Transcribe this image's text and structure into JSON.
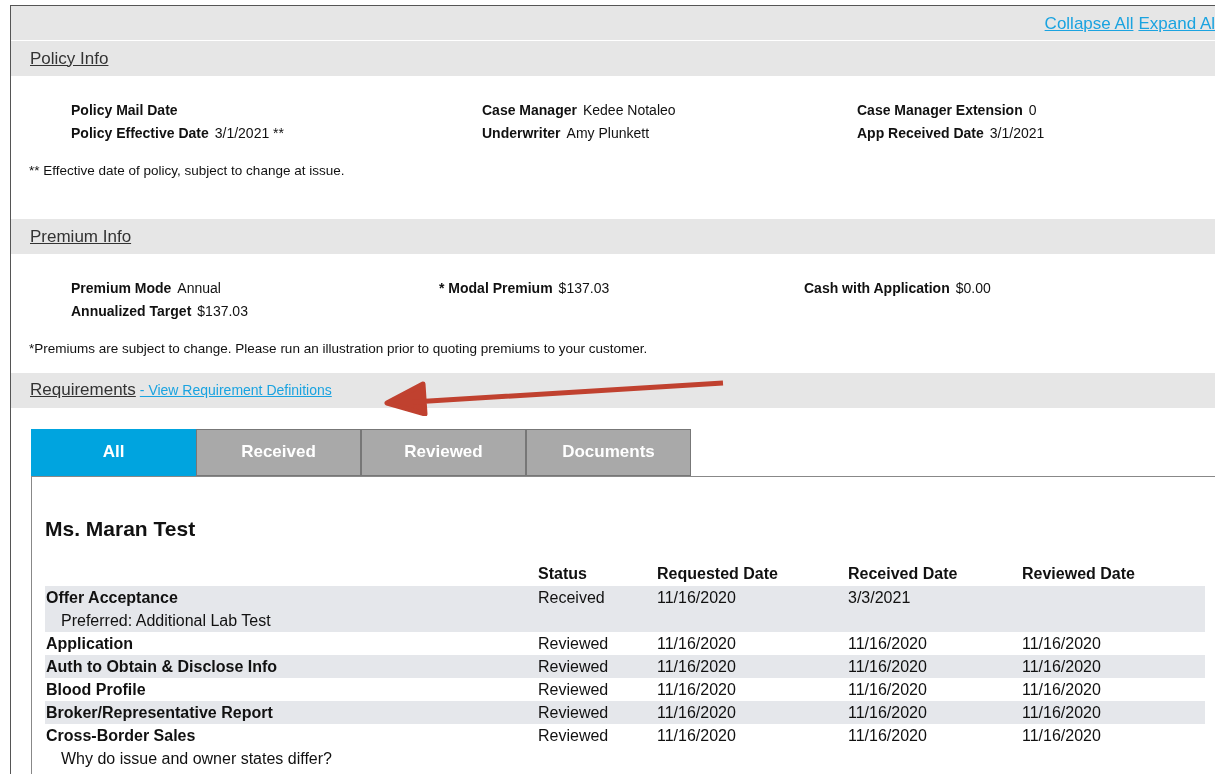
{
  "toolbar": {
    "links": [
      "Collapse All",
      "Expand Al"
    ]
  },
  "policy_info": {
    "title": "Policy Info",
    "columns": [
      [
        {
          "label": "Policy Mail Date"
        },
        {
          "label": "Policy Effective Date",
          "value": "3/1/2021 **"
        }
      ],
      [
        {
          "label": "Case Manager",
          "value": "Kedee Notaleo"
        },
        {
          "label": "Underwriter",
          "value": "Amy Plunkett"
        }
      ],
      [
        {
          "label": "Case Manager Extension",
          "value": "0"
        },
        {
          "label": "App Received Date",
          "value": "3/1/2021"
        }
      ]
    ],
    "note": "** Effective date of policy, subject to change at issue."
  },
  "premium_info": {
    "title": "Premium Info",
    "columns": [
      [
        {
          "label": "Premium Mode",
          "value": "Annual"
        },
        {
          "label": "Annualized Target",
          "value": "$137.03"
        }
      ],
      [
        {
          "label": "* Modal Premium",
          "value": "$137.03"
        }
      ],
      [
        {
          "label": "Cash with Application",
          "value": "$0.00"
        }
      ]
    ],
    "note": "*Premiums are subject to change. Please run an illustration prior to quoting premiums to your customer."
  },
  "requirements": {
    "title": "Requirements",
    "link": "- View Requirement Definitions",
    "tabs": [
      {
        "label": "All",
        "selected": true
      },
      {
        "label": "Received",
        "selected": false
      },
      {
        "label": "Reviewed",
        "selected": false
      },
      {
        "label": "Documents",
        "selected": false
      }
    ],
    "insured": "Ms. Maran Test",
    "table": {
      "columns": [
        "Status",
        "Requested Date",
        "Received Date",
        "Reviewed Date"
      ],
      "rows": [
        {
          "name": "Offer Acceptance",
          "status": "Received",
          "requested": "11/16/2020",
          "received": "3/3/2021",
          "note": "Preferred: Additional Lab Test"
        },
        {
          "name": "Application",
          "status": "Reviewed",
          "requested": "11/16/2020",
          "received": "11/16/2020",
          "reviewed": "11/16/2020"
        },
        {
          "name": "Auth to Obtain & Disclose Info",
          "status": "Reviewed",
          "requested": "11/16/2020",
          "received": "11/16/2020",
          "reviewed": "11/16/2020"
        },
        {
          "name": "Blood Profile",
          "status": "Reviewed",
          "requested": "11/16/2020",
          "received": "11/16/2020",
          "reviewed": "11/16/2020"
        },
        {
          "name": "Broker/Representative Report",
          "status": "Reviewed",
          "requested": "11/16/2020",
          "received": "11/16/2020",
          "reviewed": "11/16/2020"
        },
        {
          "name": "Cross-Border Sales",
          "status": "Reviewed",
          "requested": "11/16/2020",
          "received": "11/16/2020",
          "reviewed": "11/16/2020",
          "note": "Why do issue and owner states differ?"
        }
      ]
    }
  }
}
